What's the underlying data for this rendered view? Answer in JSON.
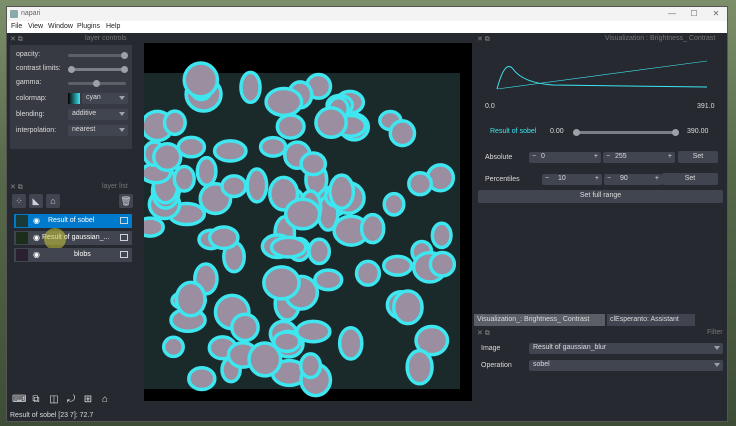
{
  "app": {
    "title": "napari"
  },
  "window_controls": {
    "minimize": "—",
    "maximize": "☐",
    "close": "✕"
  },
  "menu": {
    "items": [
      "File",
      "View",
      "Window",
      "Plugins",
      "Help"
    ]
  },
  "layer_controls": {
    "title": "layer controls",
    "opacity_label": "opacity:",
    "contrast_label": "contrast limits:",
    "gamma_label": "gamma:",
    "colormap_label": "colormap:",
    "colormap_value": "cyan",
    "blending_label": "blending:",
    "blending_value": "additive",
    "interpolation_label": "interpolation:",
    "interpolation_value": "nearest",
    "opacity_value": 1.0,
    "gamma_value": 1.0
  },
  "layer_list": {
    "title": "layer list",
    "layers": [
      {
        "name": "Result of sobel"
      },
      {
        "name": "Result of gaussian_..."
      },
      {
        "name": "blobs"
      }
    ]
  },
  "status": {
    "text": "Result of sobel [23  7]: 72.7"
  },
  "bc_panel": {
    "title": "Visualization : Brightness_ Contrast",
    "hist_min": "0.0",
    "hist_max": "391.0",
    "layer_name": "Result of sobel",
    "range_min": "0.00",
    "range_max": "390.00",
    "absolute_label": "Absolute",
    "abs_low": "0",
    "abs_high": "255",
    "set_label": "Set",
    "percentiles_label": "Percentiles",
    "pct_low": "10",
    "pct_high": "90",
    "set_full_range_label": "Set full range"
  },
  "tabs": {
    "tab1": "Visualization_: Brightness_ Contrast",
    "tab2": "clEsperanto: Assistant"
  },
  "filter_panel": {
    "title": "Filter",
    "image_label": "Image",
    "image_value": "Result of gaussian_blur",
    "operation_label": "Operation",
    "operation_value": "sobel"
  },
  "colors": {
    "accent": "#007acc",
    "cyan": "#3ee6f0",
    "bg": "#262930",
    "panel": "#373a42"
  }
}
